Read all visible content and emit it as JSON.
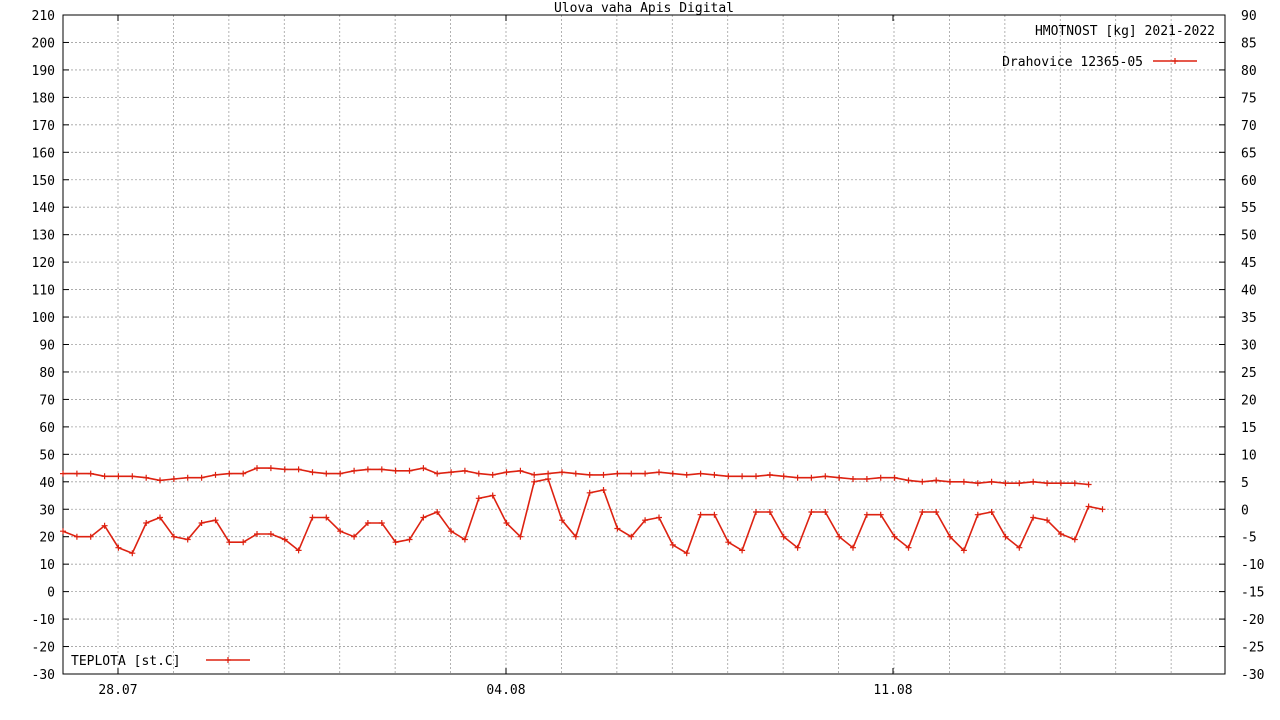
{
  "chart_data": {
    "type": "line",
    "title": "Ulova vaha Apis Digital",
    "label_top_right": "HMOTNOST [kg] 2021-2022",
    "x_tick_labels": [
      "28.07",
      "04.08",
      "11.08"
    ],
    "y_left": {
      "ylim": [
        -30,
        210
      ],
      "ticks": [
        -30,
        -20,
        -10,
        0,
        10,
        20,
        30,
        40,
        50,
        60,
        70,
        80,
        90,
        100,
        110,
        120,
        130,
        140,
        150,
        160,
        170,
        180,
        190,
        200,
        210
      ]
    },
    "y_right": {
      "ylim": [
        -30,
        90
      ],
      "ticks": [
        -30,
        -25,
        -20,
        -15,
        -10,
        -5,
        0,
        5,
        10,
        15,
        20,
        25,
        30,
        35,
        40,
        45,
        50,
        55,
        60,
        65,
        70,
        75,
        80,
        85,
        90
      ]
    },
    "grid": true,
    "colors": {
      "series": "#dd2211",
      "grid": "#a0a0a0",
      "axis": "#000000"
    },
    "series": [
      {
        "name": "Drahovice 12365-05",
        "axis": "left",
        "legend": "top-right",
        "values": [
          43,
          43,
          43,
          42,
          42,
          42,
          41.5,
          40.5,
          41,
          41.5,
          41.5,
          42.5,
          43,
          43,
          45,
          45,
          44.5,
          44.5,
          43.5,
          43,
          43,
          44,
          44.5,
          44.5,
          44,
          44,
          45,
          43,
          43.5,
          44,
          43,
          42.5,
          43.5,
          44,
          42.5,
          43,
          43.5,
          43,
          42.5,
          42.5,
          43,
          43,
          43,
          43.5,
          43,
          42.5,
          43,
          42.5,
          42,
          42,
          42,
          42.5,
          42,
          41.5,
          41.5,
          42,
          41.5,
          41,
          41,
          41.5,
          41.5,
          40.5,
          40,
          40.5,
          40,
          40,
          39.5,
          40,
          39.5,
          39.5,
          40,
          39.5,
          39.5,
          39.5,
          39
        ]
      },
      {
        "name": "TEPLOTA [st.C]",
        "axis": "right",
        "legend": "bottom-left",
        "values": [
          -4,
          -5,
          -5,
          -3,
          -7,
          -8,
          -2.5,
          -1.5,
          -5,
          -5.5,
          -2.5,
          -2,
          -6,
          -6,
          -4.5,
          -4.5,
          -5.5,
          -7.5,
          -1.5,
          -1.5,
          -4,
          -5,
          -2.5,
          -2.5,
          -6,
          -5.5,
          -1.5,
          -0.5,
          -4,
          -5.5,
          2,
          2.5,
          -2.5,
          -5,
          5,
          5.5,
          -2,
          -5,
          3,
          3.5,
          -3.5,
          -5,
          -2,
          -1.5,
          -6.5,
          -8,
          -1,
          -1,
          -6,
          -7.5,
          -0.5,
          -0.5,
          -5,
          -7,
          -0.5,
          -0.5,
          -5,
          -7,
          -1,
          -1,
          -5,
          -7,
          -0.5,
          -0.5,
          -5,
          -7.5,
          -1,
          -0.5,
          -5,
          -7,
          -1.5,
          -2,
          -4.5,
          -5.5,
          0.5,
          0
        ]
      }
    ]
  }
}
